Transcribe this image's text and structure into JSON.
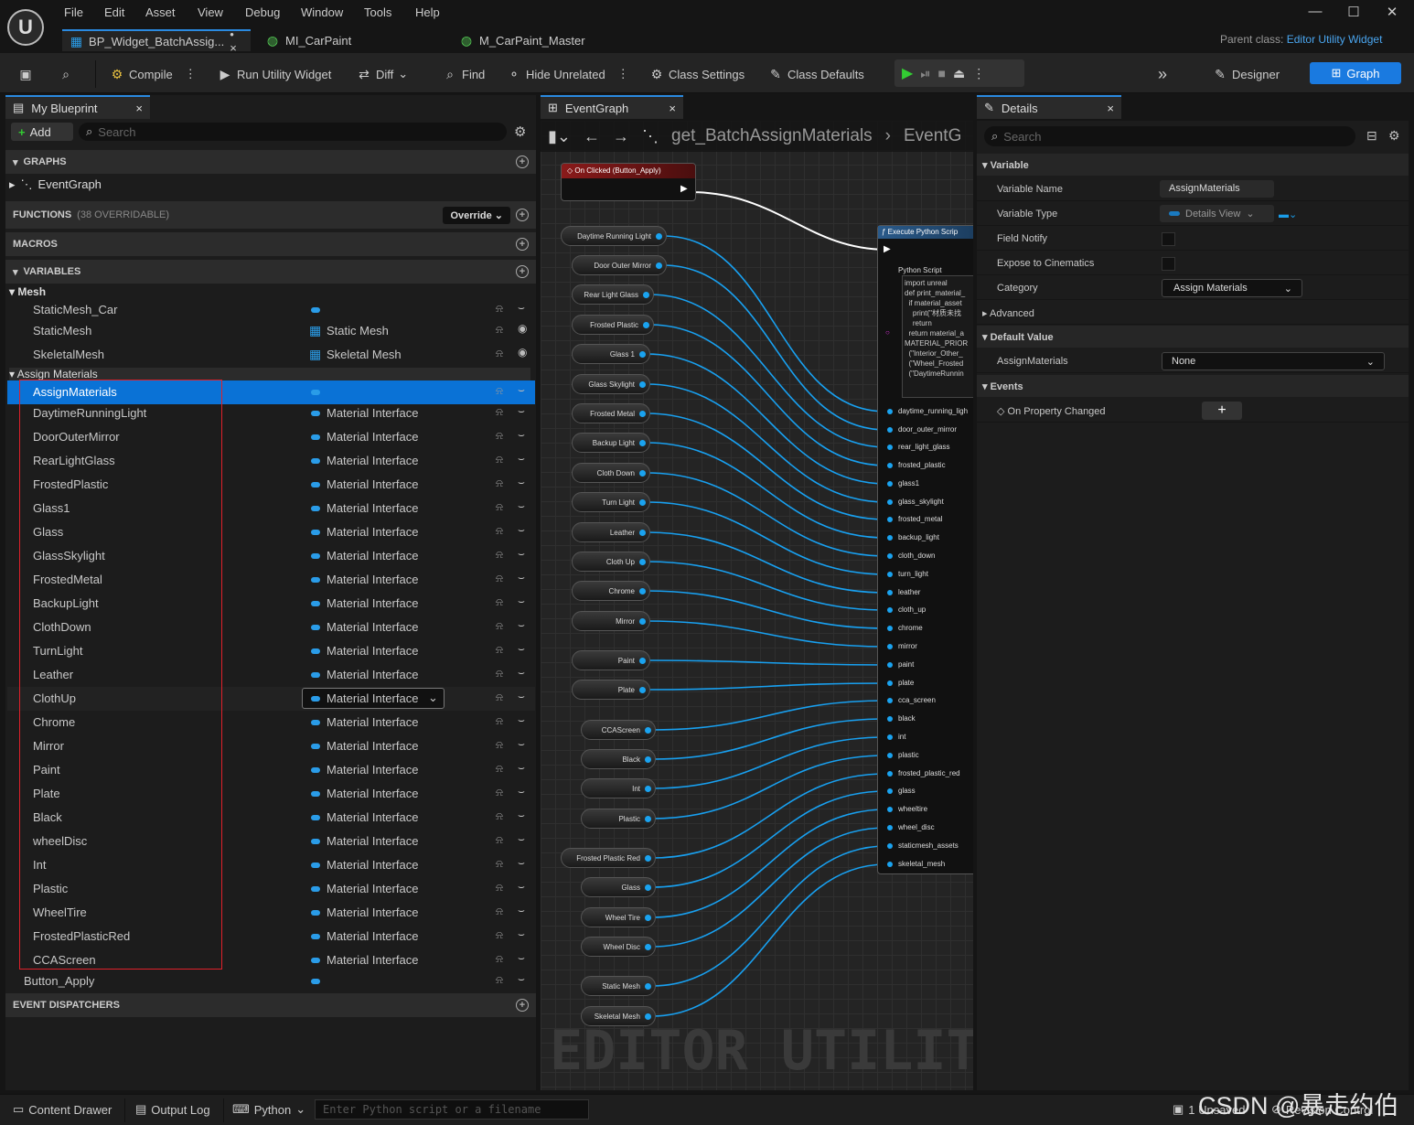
{
  "menu": [
    "File",
    "Edit",
    "Asset",
    "View",
    "Debug",
    "Window",
    "Tools",
    "Help"
  ],
  "tabs": [
    {
      "label": "BP_Widget_BatchAssig...",
      "suffix": "• ×"
    },
    {
      "label": "MI_CarPaint"
    },
    {
      "label": "M_CarPaint_Master"
    }
  ],
  "parent_class": {
    "label": "Parent class:",
    "value": "Editor Utility Widget"
  },
  "toolbar": {
    "compile": "Compile",
    "run": "Run Utility Widget",
    "diff": "Diff",
    "find": "Find",
    "hide_unrelated": "Hide Unrelated",
    "class_settings": "Class Settings",
    "class_defaults": "Class Defaults",
    "designer": "Designer",
    "graph": "Graph"
  },
  "my_blueprint": {
    "title": "My Blueprint",
    "add": "Add",
    "search_placeholder": "Search",
    "graphs_header": "GRAPHS",
    "event_graph": "EventGraph",
    "functions_header": "FUNCTIONS",
    "functions_count": "(38 OVERRIDABLE)",
    "override": "Override",
    "macros_header": "MACROS",
    "variables_header": "VARIABLES",
    "event_dispatchers_header": "EVENT DISPATCHERS"
  },
  "mesh_group": {
    "label": "Mesh",
    "items": [
      {
        "name": "StaticMesh_Car",
        "type": ""
      },
      {
        "name": "StaticMesh",
        "type": "Static Mesh"
      },
      {
        "name": "SkeletalMesh",
        "type": "Skeletal Mesh"
      }
    ]
  },
  "assign_group": {
    "label": "Assign Materials",
    "selected": "AssignMaterials",
    "items": [
      "DaytimeRunningLight",
      "DoorOuterMirror",
      "RearLightGlass",
      "FrostedPlastic",
      "Glass1",
      "Glass",
      "GlassSkylight",
      "FrostedMetal",
      "BackupLight",
      "ClothDown",
      "TurnLight",
      "Leather",
      "ClothUp",
      "Chrome",
      "Mirror",
      "Paint",
      "Plate",
      "Black",
      "wheelDisc",
      "Int",
      "Plastic",
      "WheelTire",
      "FrostedPlasticRed",
      "CCAScreen"
    ],
    "type_label": "Material Interface"
  },
  "button_apply": "Button_Apply",
  "graph": {
    "tab": "EventGraph",
    "breadcrumb": "get_BatchAssignMaterials",
    "breadcrumb_tail": "EventG",
    "event_node": "On Clicked (Button_Apply)",
    "exec_node": "Execute Python Scrip",
    "python_label": "Python Script",
    "python_code": [
      "import unreal",
      "",
      "def print_material_",
      "  if material_asset",
      "    print(\"材质未找",
      "    return",
      "  return material_a",
      "",
      "MATERIAL_PRIOR",
      "  (\"Interior_Other_",
      "  (\"Wheel_Frosted",
      "  (\"DaytimeRunnin"
    ],
    "var_nodes": [
      "Daytime Running Light",
      "Door Outer Mirror",
      "Rear Light Glass",
      "Frosted Plastic",
      "Glass 1",
      "Glass Skylight",
      "Frosted Metal",
      "Backup Light",
      "Cloth Down",
      "Turn Light",
      "Leather",
      "Cloth Up",
      "Chrome",
      "Mirror",
      "Paint",
      "Plate",
      "CCAScreen",
      "Black",
      "Int",
      "Plastic",
      "Frosted Plastic Red",
      "Glass",
      "Wheel Tire",
      "Wheel Disc",
      "Static Mesh",
      "Skeletal Mesh"
    ],
    "input_pins": [
      "daytime_running_ligh",
      "door_outer_mirror",
      "rear_light_glass",
      "frosted_plastic",
      "glass1",
      "glass_skylight",
      "frosted_metal",
      "backup_light",
      "cloth_down",
      "turn_light",
      "leather",
      "cloth_up",
      "chrome",
      "mirror",
      "paint",
      "plate",
      "cca_screen",
      "black",
      "int",
      "plastic",
      "frosted_plastic_red",
      "glass",
      "wheeltire",
      "wheel_disc",
      "staticmesh_assets",
      "skeletal_mesh"
    ],
    "watermark": "EDITOR UTILITY W"
  },
  "details": {
    "title": "Details",
    "search_placeholder": "Search",
    "variable_section": "Variable",
    "variable_name_label": "Variable Name",
    "variable_name": "AssignMaterials",
    "variable_type_label": "Variable Type",
    "variable_type": "Details View",
    "field_notify": "Field Notify",
    "expose": "Expose to Cinematics",
    "category_label": "Category",
    "category": "Assign Materials",
    "advanced": "Advanced",
    "default_value_section": "Default Value",
    "default_label": "AssignMaterials",
    "default_value": "None",
    "events_section": "Events",
    "on_property_changed": "On Property Changed"
  },
  "statusbar": {
    "content_drawer": "Content Drawer",
    "output_log": "Output Log",
    "python": "Python",
    "cmd_placeholder": "Enter Python script or a filename",
    "unsaved": "1 Unsaved",
    "revision": "Revision Control",
    "watermark": "CSDN @暴走约伯"
  }
}
